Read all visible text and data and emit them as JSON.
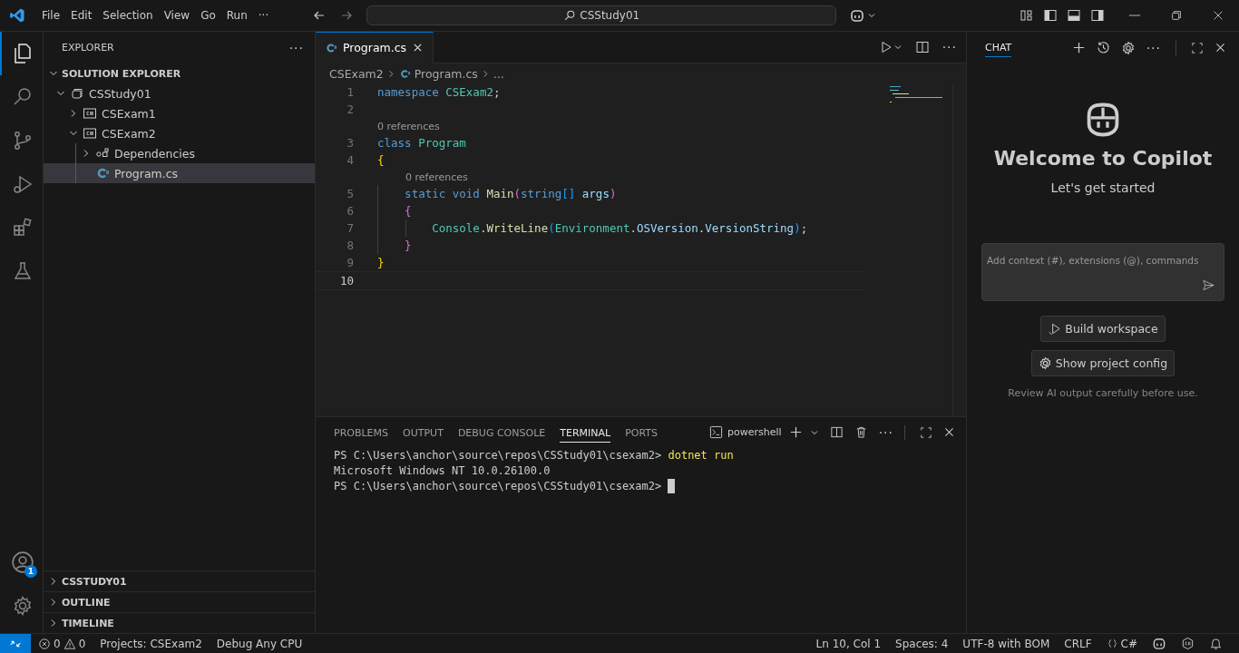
{
  "title_bar": {
    "menu": [
      "File",
      "Edit",
      "Selection",
      "View",
      "Go",
      "Run"
    ],
    "more": "···",
    "search": "CSStudy01"
  },
  "activity_bar": {
    "items": [
      {
        "selected": true
      },
      {
        "selected": false
      },
      {
        "selected": false
      },
      {
        "selected": false
      },
      {
        "selected": false
      },
      {
        "selected": false
      }
    ],
    "accounts_badge": "1"
  },
  "sidebar": {
    "title": "EXPLORER",
    "more": "···",
    "section": "SOLUTION EXPLORER",
    "tree": [
      {
        "label": "CSStudy01",
        "kind": "solution",
        "expanded": true,
        "selected": false,
        "children": [
          {
            "label": "CSExam1",
            "kind": "project",
            "expanded": false,
            "selected": false
          },
          {
            "label": "CSExam2",
            "kind": "project",
            "expanded": true,
            "selected": false,
            "children": [
              {
                "label": "Dependencies",
                "kind": "dependencies",
                "expanded": false,
                "selected": false
              },
              {
                "label": "Program.cs",
                "kind": "file",
                "selected": true
              }
            ]
          }
        ]
      }
    ],
    "collapsed_sections": [
      "CSSTUDY01",
      "OUTLINE",
      "TIMELINE"
    ]
  },
  "editor": {
    "tab": {
      "label": "Program.cs",
      "selected": true
    },
    "breadcrumbs": [
      "CSExam2",
      "Program.cs",
      "..."
    ],
    "lines": [
      {
        "kind": "code",
        "number": "1",
        "tokens": [
          {
            "text": "namespace ",
            "kind": "keyword"
          },
          {
            "text": "CSExam2",
            "kind": "type"
          },
          {
            "text": ";",
            "kind": "plain"
          }
        ]
      },
      {
        "kind": "code",
        "number": "2"
      },
      {
        "kind": "codelens",
        "text": "0 references"
      },
      {
        "kind": "code",
        "number": "3",
        "tokens": [
          {
            "text": "class ",
            "kind": "keyword"
          },
          {
            "text": "Program",
            "kind": "type"
          }
        ]
      },
      {
        "kind": "code",
        "number": "4",
        "tokens": [
          {
            "text": "{",
            "kind": "bracket1"
          }
        ]
      },
      {
        "kind": "codelens",
        "text": "0 references"
      },
      {
        "kind": "code",
        "number": "5",
        "tokens": [
          {
            "text": "    static void ",
            "kind": "keyword"
          },
          {
            "text": "Main",
            "kind": "function"
          },
          {
            "text": "(",
            "kind": "bracket2"
          },
          {
            "text": "string",
            "kind": "keyword"
          },
          {
            "text": "[]",
            "kind": "bracket3"
          },
          {
            "text": " args",
            "kind": "variable"
          },
          {
            "text": ")",
            "kind": "bracket2"
          }
        ]
      },
      {
        "kind": "code",
        "number": "6",
        "tokens": [
          {
            "text": "    {",
            "kind": "bracket2"
          }
        ]
      },
      {
        "kind": "code",
        "number": "7",
        "tokens": [
          {
            "text": "        Console",
            "kind": "type"
          },
          {
            "text": ".",
            "kind": "plain"
          },
          {
            "text": "WriteLine",
            "kind": "function"
          },
          {
            "text": "(",
            "kind": "bracket3"
          },
          {
            "text": "Environment",
            "kind": "type"
          },
          {
            "text": ".",
            "kind": "plain"
          },
          {
            "text": "OSVersion",
            "kind": "variable"
          },
          {
            "text": ".",
            "kind": "plain"
          },
          {
            "text": "VersionString",
            "kind": "variable"
          },
          {
            "text": ")",
            "kind": "bracket3"
          },
          {
            "text": ";",
            "kind": "plain"
          }
        ]
      },
      {
        "kind": "code",
        "number": "8",
        "tokens": [
          {
            "text": "    }",
            "kind": "bracket2"
          }
        ]
      },
      {
        "kind": "code",
        "number": "9",
        "tokens": [
          {
            "text": "}",
            "kind": "bracket1"
          }
        ]
      },
      {
        "kind": "code",
        "number": "10",
        "current": true
      }
    ]
  },
  "panel": {
    "tabs": [
      {
        "label": "PROBLEMS",
        "selected": false
      },
      {
        "label": "OUTPUT",
        "selected": false
      },
      {
        "label": "DEBUG CONSOLE",
        "selected": false
      },
      {
        "label": "TERMINAL",
        "selected": true
      },
      {
        "label": "PORTS",
        "selected": false
      }
    ],
    "terminal_name": "powershell",
    "more": "···",
    "terminal": [
      {
        "prompt": "PS C:\\Users\\anchor\\source\\repos\\CSStudy01\\csexam2> ",
        "command": "dotnet run"
      },
      {
        "output": "Microsoft Windows NT 10.0.26100.0"
      },
      {
        "prompt": "PS C:\\Users\\anchor\\source\\repos\\CSStudy01\\csexam2> ",
        "cursor": true
      }
    ]
  },
  "chat": {
    "tab": {
      "label": "CHAT",
      "selected": true
    },
    "more": "···",
    "title": "Welcome to Copilot",
    "subtitle": "Let's get started",
    "input_placeholder": "Add context (#), extensions (@), commands",
    "buttons": [
      "Build workspace",
      "Show project config"
    ],
    "disclaimer": "Review AI output carefully before use."
  },
  "status_bar": {
    "errors": "0",
    "warnings": "0",
    "left": [
      "Projects: CSExam2",
      "Debug Any CPU"
    ],
    "right": [
      "Ln 10, Col 1",
      "Spaces: 4",
      "UTF-8 with BOM",
      "CRLF"
    ],
    "language": "C#"
  }
}
